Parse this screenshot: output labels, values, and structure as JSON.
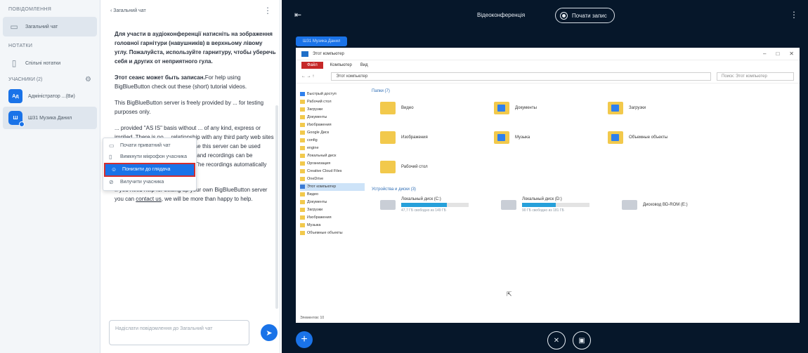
{
  "userlist": {
    "messages_heading": "ПОВІДОМЛЕННЯ",
    "public_chat": "Загальний чат",
    "notes_heading": "НОТАТКИ",
    "shared_notes": "Спільні нотатки",
    "users_heading": "УЧАСНИКИ (2)",
    "users": [
      {
        "initials": "Ад",
        "name": "Адміністратор ...(Ви)"
      },
      {
        "initials": "Ш",
        "name": "Ш31 Музика Данил"
      }
    ]
  },
  "chat": {
    "title": "‹ Загальний чат",
    "intro_bold": "Для участи в аудіоконференції натисніть на зображення головної гарнітури (навушників) в верхньому лівому углу. Пожалуйста, используйте гарнитуру, чтобы уберечь себя и других от неприятного гула.",
    "p2_bold": "Этот сеанс может быть записан.",
    "p2_rest": "For help using BigBlueButton check out these (short) tutorial videos.",
    "p3": "This BigBlueButton server is freely provided by ... for testing purposes only.",
    "p4": "... provided \"AS IS\" basis without ... of any kind, express or implied. There is no ... relationship with any third party web sites linked to this service. And because this server can be used public and openly, your sessions and recordings can be accessible for anyone, anytime. The recordings automatically delete after 7 days.",
    "p5_pre": "If you need help for setting up your own BigBlueButton server you can ",
    "p5_link": "contact us",
    "p5_post": ", we will be more than happy to help.",
    "input_placeholder": "Надіслати повідомлення до Загальний чат",
    "send_icon": "send-icon"
  },
  "context_menu": {
    "items": [
      {
        "icon": "chat-icon",
        "label": "Почати приватний чат"
      },
      {
        "icon": "mic-off-icon",
        "label": "Вимкнути мікрофон учасника"
      },
      {
        "icon": "user-icon",
        "label": "Понизити до глядача"
      },
      {
        "icon": "remove-icon",
        "label": "Вилучити учасника"
      }
    ]
  },
  "topbar": {
    "title": "Відеоконференція",
    "record_label": "Почати запис",
    "presenter_tag": "Ш31 Музика Данил"
  },
  "explorer": {
    "title": "Этот компьютер",
    "ribbon": {
      "file": "Файл",
      "tabs": [
        "Компьютер",
        "Вид"
      ]
    },
    "address": "Этот компьютер",
    "search_placeholder": "Поиск: Этот компьютер",
    "nav": [
      "Быстрый доступ",
      "Рабочий стол",
      "Загрузки",
      "Документы",
      "Изображения",
      "Google Диск",
      "config",
      "engine",
      "Локальный диск",
      "Организация",
      "Creative Cloud Files",
      "OneDrive",
      "Этот компьютер",
      "Видео",
      "Документы",
      "Загрузки",
      "Изображения",
      "Музыка",
      "Объемные объекты"
    ],
    "folders_group": "Папки (7)",
    "folders": [
      "Видео",
      "Документы",
      "Загрузки",
      "Изображения",
      "Музыка",
      "Объемные объекты",
      "Рабочий стол"
    ],
    "devices_group": "Устройства и диски (3)",
    "drives": [
      {
        "name": "Локальный диск (C:)",
        "free": "47,7 ГБ свободно из 149 ГБ",
        "used": 0.68
      },
      {
        "name": "Локальный диск (D:)",
        "free": "90 ГБ свободно из 181 ГБ",
        "used": 0.5
      },
      {
        "name": "Дисковод BD-ROM (E:)",
        "free": "",
        "used": 0
      }
    ],
    "status": "Элементов: 10"
  },
  "controls": {
    "fab_icon": "plus-icon",
    "mic_icon": "mic-muted-icon",
    "share_icon": "screen-share-icon"
  }
}
